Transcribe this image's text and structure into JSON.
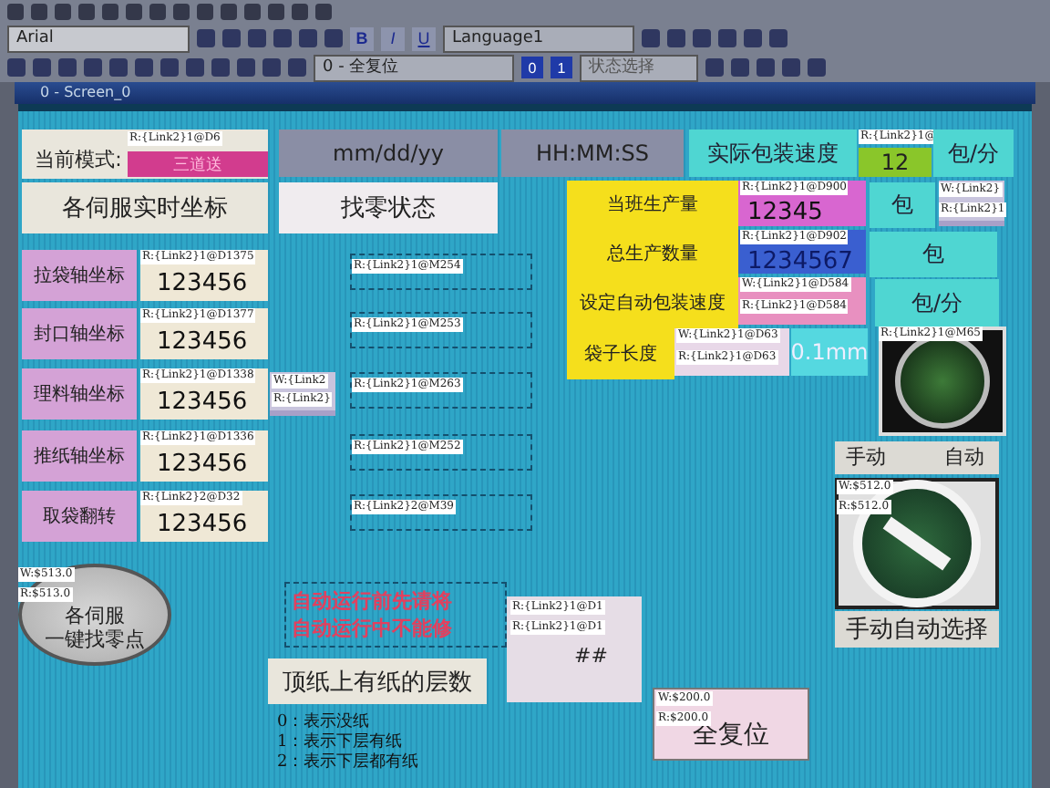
{
  "toolbar": {
    "font": "Arial",
    "format_buttons": [
      "B",
      "I",
      "U"
    ],
    "language": "Language1",
    "state_dropdown": "0 - 全复位",
    "state_buttons": [
      "0",
      "1"
    ],
    "state_select": "状态选择"
  },
  "window": {
    "title": "0 - Screen_0"
  },
  "mode": {
    "label": "当前模式:",
    "tag": "R:{Link2}1@D6",
    "value": "三道送"
  },
  "date": "mm/dd/yy",
  "time": "HH:MM:SS",
  "speed": {
    "label": "实际包装速度",
    "tag": "R:{Link2}1@",
    "value": "12",
    "unit": "包/分"
  },
  "servo_header": "各伺服实时坐标",
  "homing_header": "找零状态",
  "axes": [
    {
      "label": "拉袋轴坐标",
      "tag": "R:{Link2}1@D1375",
      "value": "123456"
    },
    {
      "label": "封口轴坐标",
      "tag": "R:{Link2}1@D1377",
      "value": "123456"
    },
    {
      "label": "理料轴坐标",
      "tag": "R:{Link2}1@D1338",
      "value": "123456"
    },
    {
      "label": "推纸轴坐标",
      "tag": "R:{Link2}1@D1336",
      "value": "123456"
    },
    {
      "label": "取袋翻转",
      "tag": "R:{Link2}2@D32",
      "value": "123456"
    }
  ],
  "small_widget": [
    "W:{Link2",
    "R:{Link2}"
  ],
  "homing_tags": [
    "R:{Link2}1@M254",
    "R:{Link2}1@M253",
    "R:{Link2}1@M263",
    "R:{Link2}1@M252",
    "R:{Link2}2@M39"
  ],
  "production": [
    {
      "label": "当班生产量",
      "tags": [
        "R:{Link2}1@D900"
      ],
      "value": "12345",
      "unit": "包",
      "color": "#d866d0"
    },
    {
      "label": "总生产数量",
      "tags": [
        "R:{Link2}1@D902"
      ],
      "value": "1234567",
      "unit": "包",
      "color": "#3a5fd0"
    },
    {
      "label": "设定自动包装速度",
      "tags": [
        "W:{Link2}1@D584",
        "R:{Link2}1@D584"
      ],
      "unit": "包/分",
      "color": "#e890c0"
    },
    {
      "label": "袋子长度",
      "tags": [
        "W:{Link2}1@D63",
        "R:{Link2}1@D63"
      ],
      "unit": "0.1mm",
      "color": "#e8d8e8"
    }
  ],
  "side_tag": [
    "W:{Link2}",
    "R:{Link2}1"
  ],
  "lamp": {
    "tag": "R:{Link2}1@M65"
  },
  "selector": {
    "on": false,
    "left": "手动",
    "right": "自动",
    "tags": [
      "W:$512.0",
      "R:$512.0"
    ],
    "caption": "手动自动选择"
  },
  "home_button": {
    "tags": [
      "W:$513.0",
      "R:$513.0"
    ],
    "lines": [
      "各伺服",
      "一键找零点"
    ]
  },
  "warning": [
    "自动运行前先请将",
    "自动运行中不能修"
  ],
  "display": {
    "tags": [
      "R:{Link2}1@D1",
      "R:{Link2}1@D1"
    ],
    "value": "##"
  },
  "layers_label": "顶纸上有纸的层数",
  "legend": [
    "0：表示没纸",
    "1：表示下层有纸",
    "2：表示下层都有纸"
  ],
  "reset_button": {
    "tags": [
      "W:$200.0",
      "R:$200.0"
    ],
    "label": "全复位"
  }
}
